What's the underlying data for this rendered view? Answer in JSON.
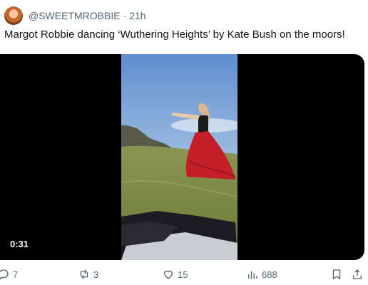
{
  "tweet": {
    "handle": "@SWEETMROBBIE",
    "separator": "·",
    "time": "21h",
    "text": "Margot Robbie dancing ‘Wuthering Heights’ by Kate Bush on the moors!"
  },
  "media": {
    "duration": "0:31"
  },
  "actions": {
    "replies": "7",
    "retweets": "3",
    "likes": "15",
    "views": "688"
  },
  "icons": [
    "reply-icon",
    "retweet-icon",
    "like-icon",
    "views-icon",
    "bookmark-icon",
    "share-icon"
  ],
  "colors": {
    "muted": "#536471",
    "dress": "#c41e2a",
    "sky": "#8fb0d8",
    "grass": "#7f8a3d"
  }
}
